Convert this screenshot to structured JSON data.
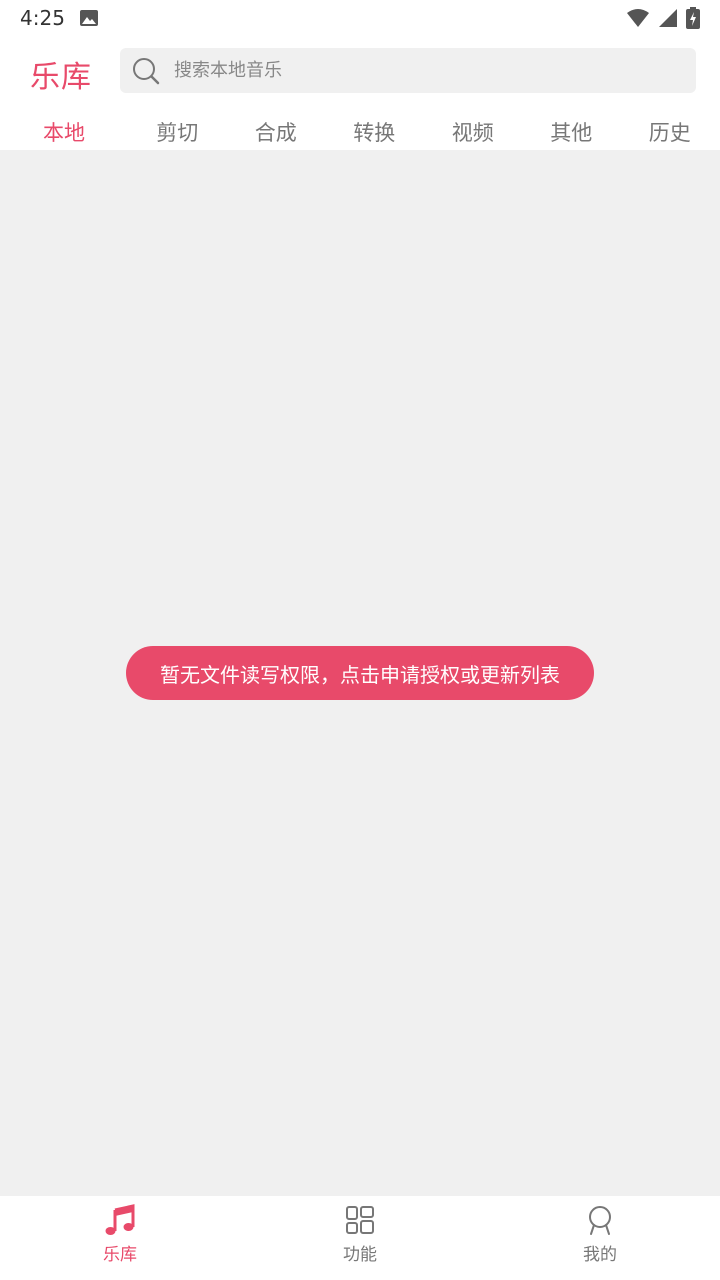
{
  "status_bar": {
    "time": "4:25",
    "icons": [
      "image-icon",
      "wifi-icon",
      "signal-icon",
      "battery-charging-icon"
    ]
  },
  "header": {
    "title": "乐库",
    "search_placeholder": "搜索本地音乐"
  },
  "tabs": [
    {
      "label": "本地",
      "active": true
    },
    {
      "label": "剪切",
      "active": false
    },
    {
      "label": "合成",
      "active": false
    },
    {
      "label": "转换",
      "active": false
    },
    {
      "label": "视频",
      "active": false
    },
    {
      "label": "其他",
      "active": false
    },
    {
      "label": "历史",
      "active": false
    }
  ],
  "permission_message": "暂无文件读写权限，点击申请授权或更新列表",
  "bottom_nav": [
    {
      "label": "乐库",
      "icon": "music-note-icon",
      "active": true
    },
    {
      "label": "功能",
      "icon": "grid-icon",
      "active": false
    },
    {
      "label": "我的",
      "icon": "profile-icon",
      "active": false
    }
  ],
  "colors": {
    "accent": "#e84a6a",
    "background": "#f0f0f0",
    "inactive_text": "#777777"
  }
}
